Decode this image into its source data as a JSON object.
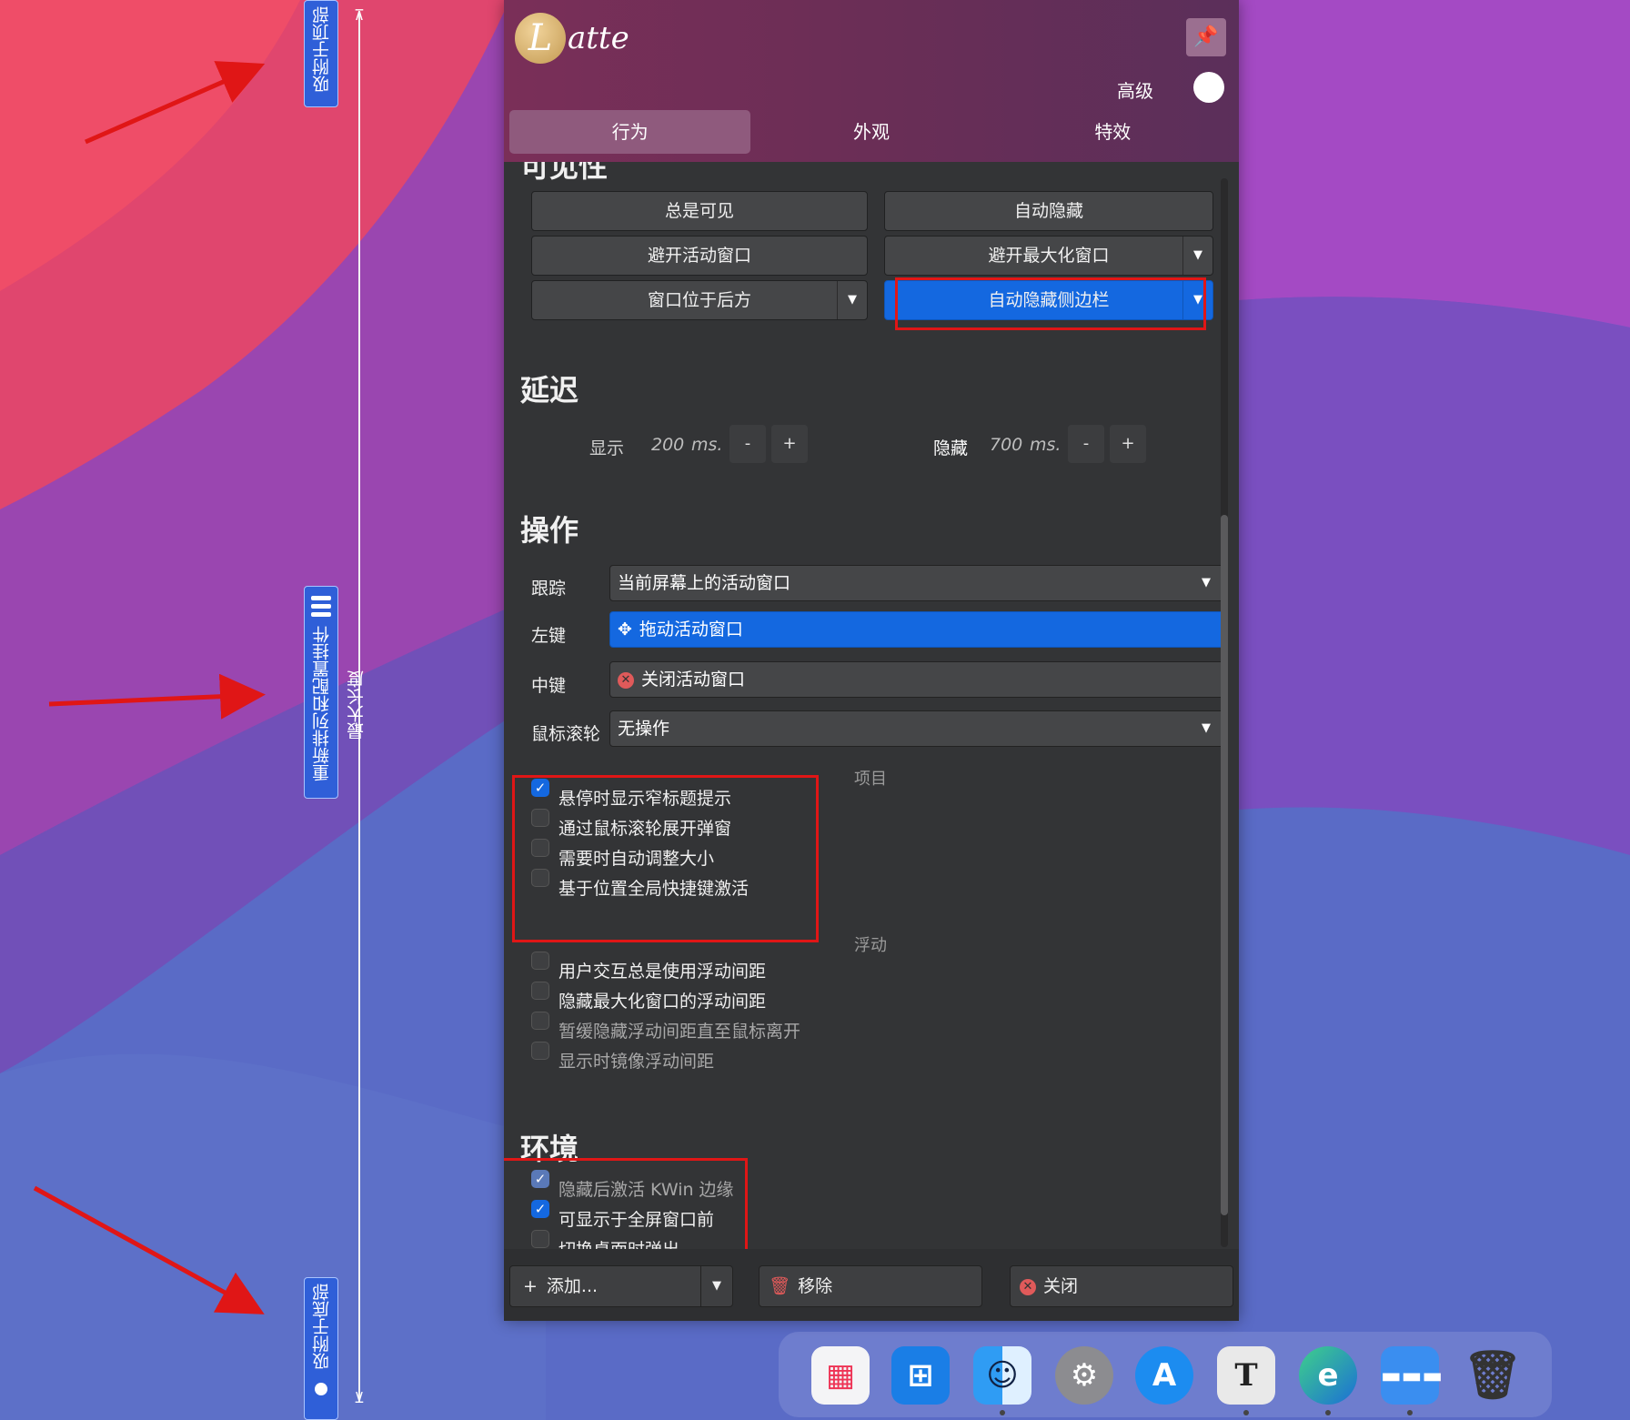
{
  "app": {
    "logo_letter": "L",
    "logo_text": "atte",
    "advanced_label": "高级"
  },
  "tabs": [
    {
      "label": "行为",
      "active": true
    },
    {
      "label": "外观",
      "active": false
    },
    {
      "label": "特效",
      "active": false
    }
  ],
  "visibility": {
    "title_partial": "可见性",
    "buttons": [
      "总是可见",
      "自动隐藏",
      "避开活动窗口",
      "避开最大化窗口",
      "窗口位于后方",
      "自动隐藏侧边栏"
    ],
    "selected": "自动隐藏侧边栏"
  },
  "delay": {
    "title": "延迟",
    "show_label": "显示",
    "show_value": "200",
    "unit": "ms.",
    "hide_label": "隐藏",
    "hide_value": "700",
    "minus": "-",
    "plus": "+"
  },
  "actions": {
    "title": "操作",
    "rows": [
      {
        "label": "跟踪",
        "value": "当前屏幕上的活动窗口"
      },
      {
        "label": "左键",
        "value": "拖动活动窗口"
      },
      {
        "label": "中键",
        "value": "关闭活动窗口"
      },
      {
        "label": "鼠标滚轮",
        "value": "无操作"
      }
    ],
    "items_group": "项目",
    "items": [
      {
        "label": "悬停时显示窄标题提示",
        "checked": true
      },
      {
        "label": "通过鼠标滚轮展开弹窗",
        "checked": false
      },
      {
        "label": "需要时自动调整大小",
        "checked": false
      },
      {
        "label": "基于位置全局快捷键激活",
        "checked": false
      }
    ],
    "float_group": "浮动",
    "floating": [
      {
        "label": "用户交互总是使用浮动间距",
        "checked": false,
        "dim": false
      },
      {
        "label": "隐藏最大化窗口的浮动间距",
        "checked": false,
        "dim": false
      },
      {
        "label": "暂缓隐藏浮动间距直至鼠标离开",
        "checked": false,
        "dim": true
      },
      {
        "label": "显示时镜像浮动间距",
        "checked": false,
        "dim": true
      }
    ]
  },
  "environment": {
    "title": "环境",
    "items": [
      {
        "label": "隐藏后激活 KWin 边缘",
        "checked": true,
        "dim": true
      },
      {
        "label": "可显示于全屏窗口前",
        "checked": true,
        "dim": false
      },
      {
        "label": "切换桌面时弹出",
        "checked": false,
        "dim": false
      }
    ]
  },
  "footer": {
    "add_label": "添加...",
    "remove_label": "移除",
    "close_label": "关闭"
  },
  "edit_ruler": {
    "top_button": "吸附于顶部",
    "middle_button": "重新排列和配置挂件",
    "bottom_button": "吸附于底部",
    "max_length_label": "最大长度"
  },
  "dock_icons": [
    "launchpad-icon",
    "windows-icon",
    "finder-icon",
    "system-settings-icon",
    "app-store-icon",
    "text-editor-icon",
    "edge-browser-icon",
    "latte-dock-icon",
    "trash-icon"
  ],
  "colors": {
    "accent": "#1468e0",
    "annotation_red": "#e01616",
    "panel_bg": "#333436"
  }
}
